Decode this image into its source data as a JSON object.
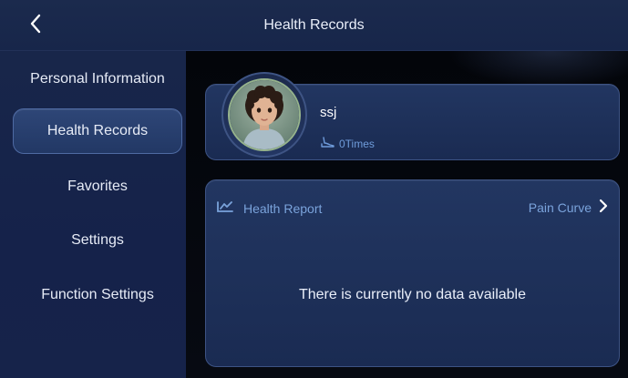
{
  "header": {
    "title": "Health Records",
    "back_icon": "chevron-left-icon"
  },
  "sidebar": {
    "items": [
      {
        "label": "Personal Information",
        "active": false
      },
      {
        "label": "Health Records",
        "active": true
      },
      {
        "label": "Favorites",
        "active": false
      },
      {
        "label": "Settings",
        "active": false
      },
      {
        "label": "Function Settings",
        "active": false
      }
    ]
  },
  "profile": {
    "username": "ssj",
    "times": "0Times",
    "times_icon": "foot-icon",
    "avatar": "child-photo"
  },
  "report": {
    "title": "Health Report",
    "title_icon": "line-chart-icon",
    "link_label": "Pain Curve",
    "link_icon": "chevron-right-icon",
    "empty_message": "There is currently no data available"
  },
  "colors": {
    "header_bg": "#1a294c",
    "sidebar_bg": "#17254a",
    "accent_text": "#7aa3db",
    "card_border": "#3d5384"
  }
}
